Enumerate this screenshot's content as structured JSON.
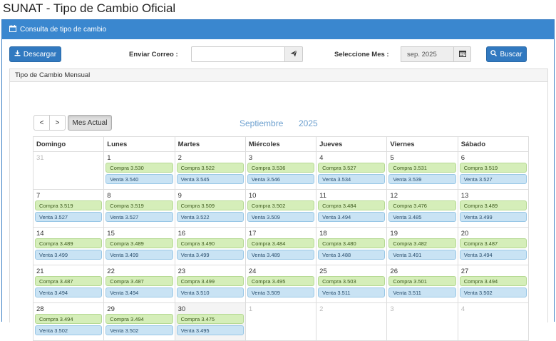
{
  "page_title": "SUNAT - Tipo de Cambio Oficial",
  "panel_title": "Consulta de tipo de cambio",
  "toolbar": {
    "download_label": "Descargar",
    "email_label": "Enviar Correo :",
    "email_value": "",
    "month_label": "Seleccione Mes :",
    "month_value": "sep. 2025",
    "search_label": "Buscar"
  },
  "subpanel_title": "Tipo de Cambio Mensual",
  "calendar": {
    "prev": "<",
    "next": ">",
    "today": "Mes Actual",
    "month_name": "Septiembre",
    "year": "2025",
    "weekdays": [
      "Domingo",
      "Lunes",
      "Martes",
      "Miércoles",
      "Jueves",
      "Viernes",
      "Sábado"
    ],
    "weeks": [
      [
        {
          "day": "31",
          "other": true
        },
        {
          "day": "1",
          "compra": "Compra 3.530",
          "venta": "Venta 3.540"
        },
        {
          "day": "2",
          "compra": "Compra 3.522",
          "venta": "Venta 3.545"
        },
        {
          "day": "3",
          "compra": "Compra 3.536",
          "venta": "Venta 3.546"
        },
        {
          "day": "4",
          "compra": "Compra 3.527",
          "venta": "Venta 3.534"
        },
        {
          "day": "5",
          "compra": "Compra 3.531",
          "venta": "Venta 3.539"
        },
        {
          "day": "6",
          "compra": "Compra 3.519",
          "venta": "Venta 3.527"
        }
      ],
      [
        {
          "day": "7",
          "compra": "Compra 3.519",
          "venta": "Venta 3.527"
        },
        {
          "day": "8",
          "compra": "Compra 3.519",
          "venta": "Venta 3.527"
        },
        {
          "day": "9",
          "compra": "Compra 3.509",
          "venta": "Venta 3.522"
        },
        {
          "day": "10",
          "compra": "Compra 3.502",
          "venta": "Venta 3.509"
        },
        {
          "day": "11",
          "compra": "Compra 3.484",
          "venta": "Venta 3.494"
        },
        {
          "day": "12",
          "compra": "Compra 3.476",
          "venta": "Venta 3.485"
        },
        {
          "day": "13",
          "compra": "Compra 3.489",
          "venta": "Venta 3.499"
        }
      ],
      [
        {
          "day": "14",
          "compra": "Compra 3.489",
          "venta": "Venta 3.499"
        },
        {
          "day": "15",
          "compra": "Compra 3.489",
          "venta": "Venta 3.499"
        },
        {
          "day": "16",
          "compra": "Compra 3.490",
          "venta": "Venta 3.499"
        },
        {
          "day": "17",
          "compra": "Compra 3.484",
          "venta": "Venta 3.489"
        },
        {
          "day": "18",
          "compra": "Compra 3.480",
          "venta": "Venta 3.488"
        },
        {
          "day": "19",
          "compra": "Compra 3.482",
          "venta": "Venta 3.491"
        },
        {
          "day": "20",
          "compra": "Compra 3.487",
          "venta": "Venta 3.494"
        }
      ],
      [
        {
          "day": "21",
          "compra": "Compra 3.487",
          "venta": "Venta 3.494"
        },
        {
          "day": "22",
          "compra": "Compra 3.487",
          "venta": "Venta 3.494"
        },
        {
          "day": "23",
          "compra": "Compra 3.499",
          "venta": "Venta 3.510"
        },
        {
          "day": "24",
          "compra": "Compra 3.495",
          "venta": "Venta 3.509"
        },
        {
          "day": "25",
          "compra": "Compra 3.503",
          "venta": "Venta 3.511"
        },
        {
          "day": "26",
          "compra": "Compra 3.501",
          "venta": "Venta 3.511"
        },
        {
          "day": "27",
          "compra": "Compra 3.494",
          "venta": "Venta 3.502"
        }
      ],
      [
        {
          "day": "28",
          "compra": "Compra 3.494",
          "venta": "Venta 3.502"
        },
        {
          "day": "29",
          "compra": "Compra 3.494",
          "venta": "Venta 3.502"
        },
        {
          "day": "30",
          "compra": "Compra 3.475",
          "venta": "Venta 3.495",
          "today": true
        },
        {
          "day": "1",
          "other": true
        },
        {
          "day": "2",
          "other": true
        },
        {
          "day": "3",
          "other": true
        },
        {
          "day": "4",
          "other": true
        }
      ]
    ]
  },
  "colors": {
    "header_blue": "#3a87cf",
    "button_blue": "#3179c0",
    "compra_green": "#d5eeb9",
    "venta_blue": "#c9e3f4"
  }
}
